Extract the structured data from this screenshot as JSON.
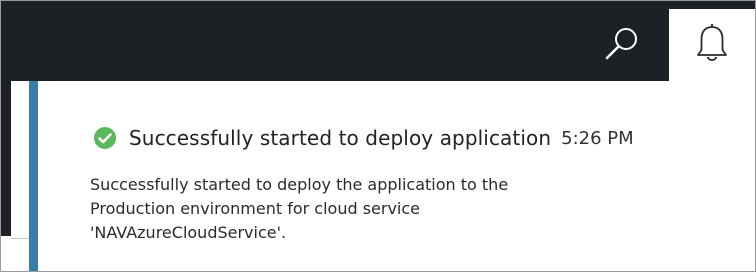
{
  "header": {
    "search_icon": "search-icon",
    "notification_icon": "bell-icon"
  },
  "notification": {
    "status_icon": "check-circle-icon",
    "status_color": "#5cb85c",
    "accent_color": "#3a7ca8",
    "title": "Successfully started to deploy application",
    "time": "5:26 PM",
    "message_lines": [
      "Successfully started to deploy the application to the",
      "Production environment for cloud service",
      "'NAVAzureCloudService'."
    ]
  }
}
